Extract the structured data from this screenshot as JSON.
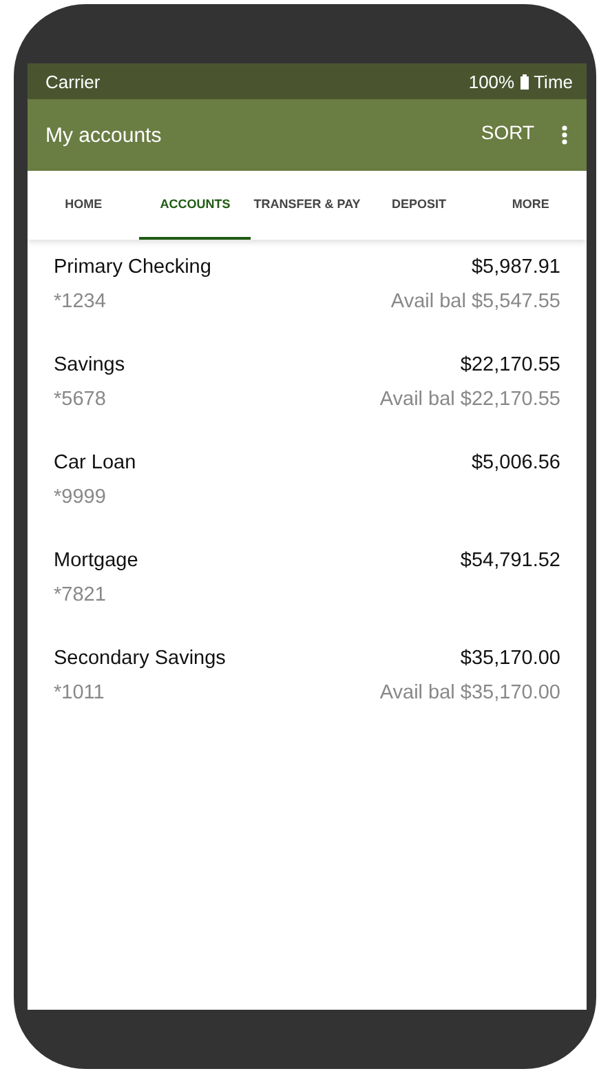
{
  "status_bar": {
    "carrier": "Carrier",
    "battery": "100%",
    "time": "Time"
  },
  "app_bar": {
    "title": "My accounts",
    "action": "SORT"
  },
  "tabs": [
    {
      "label": "HOME",
      "selected": false
    },
    {
      "label": "ACCOUNTS",
      "selected": true
    },
    {
      "label": "TRANSFER & PAY",
      "selected": false
    },
    {
      "label": "DEPOSIT",
      "selected": false
    },
    {
      "label": "MORE",
      "selected": false
    }
  ],
  "accounts": [
    {
      "name": "Primary Checking",
      "number": "*1234",
      "balance": "$5,987.91",
      "available": "Avail bal $5,547.55"
    },
    {
      "name": "Savings",
      "number": "*5678",
      "balance": "$22,170.55",
      "available": "Avail bal $22,170.55"
    },
    {
      "name": "Car Loan",
      "number": "*9999",
      "balance": "$5,006.56"
    },
    {
      "name": "Mortgage",
      "number": "*7821",
      "balance": "$54,791.52"
    },
    {
      "name": "Secondary Savings",
      "number": "*1011",
      "balance": "$35,170.00",
      "available": "Avail bal $35,170.00"
    }
  ]
}
